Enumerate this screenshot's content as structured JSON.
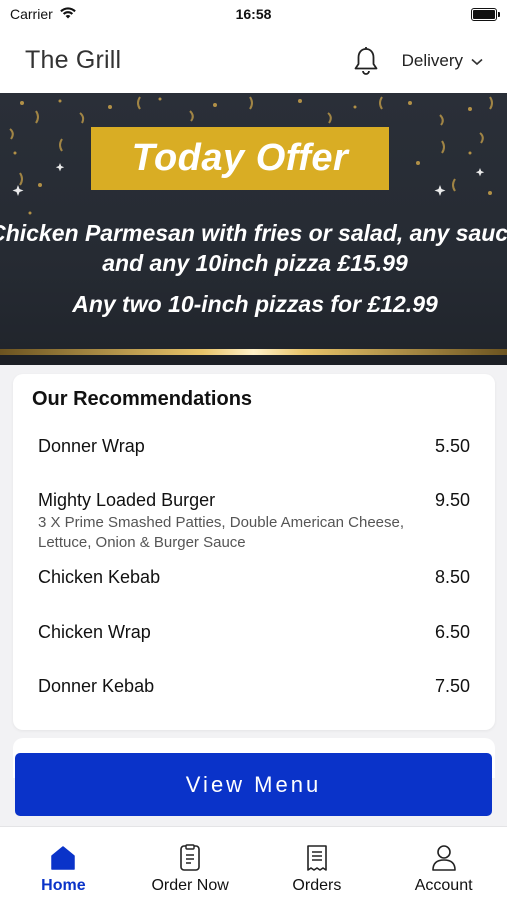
{
  "status_bar": {
    "carrier": "Carrier",
    "time": "16:58"
  },
  "header": {
    "title": "The Grill",
    "delivery_label": "Delivery"
  },
  "banner": {
    "title": "Today Offer",
    "line1": "Chicken Parmesan with fries or salad, any sauce",
    "line2": "and any 10inch pizza £15.99",
    "line3": "Any two 10-inch pizzas for £12.99",
    "accent_color": "#d9ad24"
  },
  "recommendations": {
    "title": "Our Recommendations",
    "items": [
      {
        "name": "Donner Wrap",
        "price": "5.50",
        "description": ""
      },
      {
        "name": "Mighty Loaded Burger",
        "price": "9.50",
        "description": "3 X Prime Smashed Patties, Double American Cheese, Lettuce, Onion & Burger Sauce"
      },
      {
        "name": "Chicken Kebab",
        "price": "8.50",
        "description": ""
      },
      {
        "name": "Chicken Wrap",
        "price": "6.50",
        "description": ""
      },
      {
        "name": "Donner Kebab",
        "price": "7.50",
        "description": ""
      }
    ]
  },
  "view_menu": {
    "label": "View Menu",
    "color": "#0a33c9"
  },
  "bottom_nav": {
    "items": [
      {
        "label": "Home",
        "icon": "home-icon",
        "active": true
      },
      {
        "label": "Order Now",
        "icon": "order-icon",
        "active": false
      },
      {
        "label": "Orders",
        "icon": "receipt-icon",
        "active": false
      },
      {
        "label": "Account",
        "icon": "person-icon",
        "active": false
      }
    ]
  }
}
